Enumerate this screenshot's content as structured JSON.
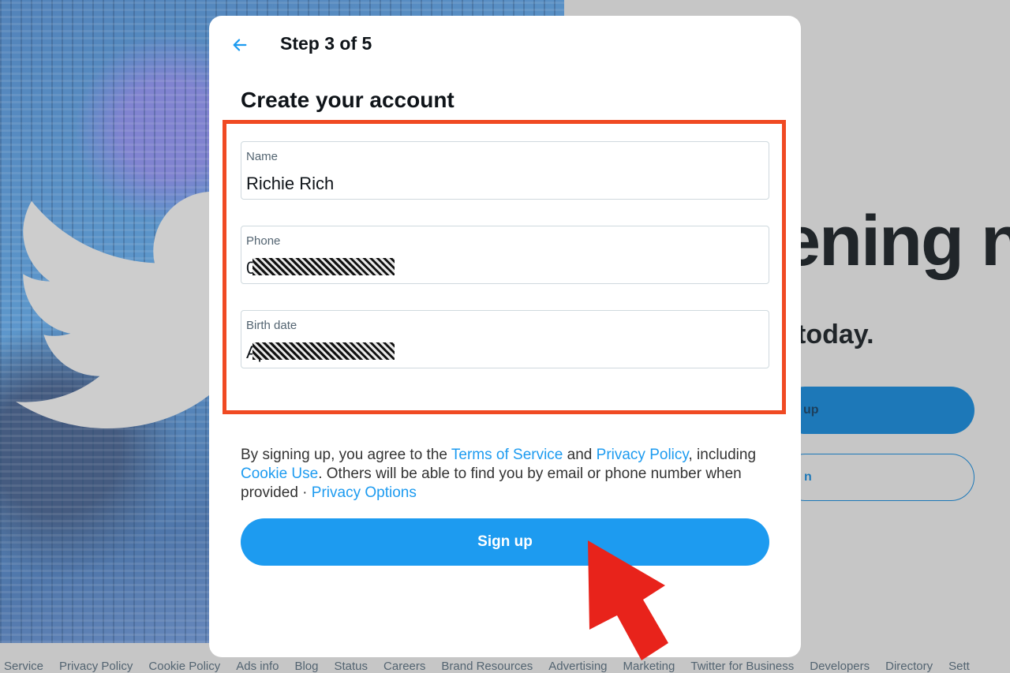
{
  "modal": {
    "step_title": "Step 3 of 5",
    "heading": "Create your account",
    "fields": {
      "name": {
        "label": "Name",
        "value": "Richie Rich"
      },
      "phone": {
        "label": "Phone",
        "value": "0"
      },
      "birth_date": {
        "label": "Birth date",
        "value": "Ap"
      }
    },
    "terms": {
      "t1": "By signing up, you agree to the ",
      "terms_link": "Terms of Service",
      "t2": " and ",
      "privacy_link": "Privacy Policy",
      "t3": ", including ",
      "cookie_link": "Cookie Use",
      "t4": ". Others will be able to find you by email or phone number when provided · ",
      "privacy_options_link": "Privacy Options"
    },
    "signup_label": "Sign up"
  },
  "background": {
    "headline": "ening n",
    "join": "today.",
    "signup_btn": "up",
    "login_btn": "n"
  },
  "footer": [
    "Service",
    "Privacy Policy",
    "Cookie Policy",
    "Ads info",
    "Blog",
    "Status",
    "Careers",
    "Brand Resources",
    "Advertising",
    "Marketing",
    "Twitter for Business",
    "Developers",
    "Directory",
    "Sett"
  ],
  "colors": {
    "accent": "#1d9bf0",
    "highlight": "#f04a23",
    "arrow": "#e8231b"
  },
  "icons": {
    "back": "arrow-left-icon",
    "bird": "twitter-bird-icon",
    "pointer": "red-pointer-arrow-icon"
  }
}
